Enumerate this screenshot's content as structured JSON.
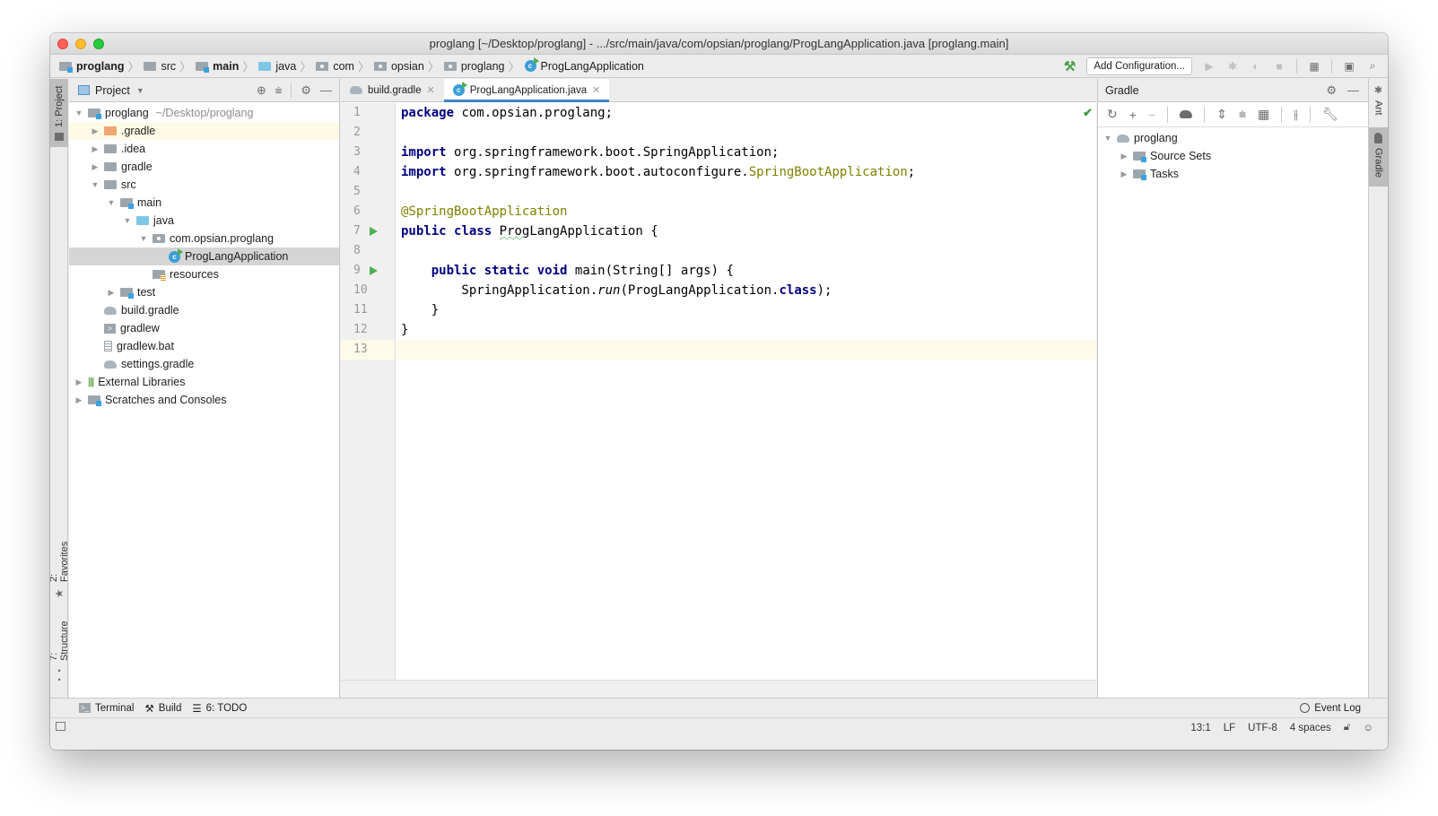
{
  "window": {
    "title": "proglang [~/Desktop/proglang] - .../src/main/java/com/opsian/proglang/ProgLangApplication.java [proglang.main]"
  },
  "navbar": {
    "breadcrumbs": [
      {
        "label": "proglang",
        "icon": "module-folder-icon",
        "bold": true
      },
      {
        "label": "src",
        "icon": "folder-icon",
        "bold": false
      },
      {
        "label": "main",
        "icon": "module-folder-icon",
        "bold": true
      },
      {
        "label": "java",
        "icon": "source-folder-icon",
        "bold": false
      },
      {
        "label": "com",
        "icon": "package-icon",
        "bold": false
      },
      {
        "label": "opsian",
        "icon": "package-icon",
        "bold": false
      },
      {
        "label": "proglang",
        "icon": "package-icon",
        "bold": false
      },
      {
        "label": "ProgLangApplication",
        "icon": "spring-class-icon",
        "bold": false
      }
    ],
    "add_configuration": "Add Configuration..."
  },
  "left_stripe": {
    "project_tab": "1: Project",
    "favorites_tab": "2: Favorites",
    "structure_tab": "7: Structure"
  },
  "right_stripe": {
    "ant_tab": "Ant",
    "gradle_tab": "Gradle"
  },
  "project_panel": {
    "title": "Project",
    "tree": [
      {
        "label": "proglang",
        "hint": "~/Desktop/proglang",
        "depth": 0,
        "arrow": "down",
        "icon": "module-folder-icon"
      },
      {
        "label": ".gradle",
        "depth": 1,
        "arrow": "right",
        "icon": "excluded-folder-icon",
        "highlight": true
      },
      {
        "label": ".idea",
        "depth": 1,
        "arrow": "right",
        "icon": "folder-icon"
      },
      {
        "label": "gradle",
        "depth": 1,
        "arrow": "right",
        "icon": "folder-icon"
      },
      {
        "label": "src",
        "depth": 1,
        "arrow": "down",
        "icon": "folder-icon"
      },
      {
        "label": "main",
        "depth": 2,
        "arrow": "down",
        "icon": "module-folder-icon"
      },
      {
        "label": "java",
        "depth": 3,
        "arrow": "down",
        "icon": "source-folder-icon"
      },
      {
        "label": "com.opsian.proglang",
        "depth": 4,
        "arrow": "down",
        "icon": "package-icon"
      },
      {
        "label": "ProgLangApplication",
        "depth": 5,
        "arrow": "",
        "icon": "spring-class-icon",
        "selected": true
      },
      {
        "label": "resources",
        "depth": 4,
        "arrow": "",
        "icon": "resources-folder-icon"
      },
      {
        "label": "test",
        "depth": 2,
        "arrow": "right",
        "icon": "module-folder-icon"
      },
      {
        "label": "build.gradle",
        "depth": 1,
        "arrow": "",
        "icon": "gradle-file-icon"
      },
      {
        "label": "gradlew",
        "depth": 1,
        "arrow": "",
        "icon": "shell-script-icon"
      },
      {
        "label": "gradlew.bat",
        "depth": 1,
        "arrow": "",
        "icon": "text-file-icon"
      },
      {
        "label": "settings.gradle",
        "depth": 1,
        "arrow": "",
        "icon": "gradle-file-icon"
      },
      {
        "label": "External Libraries",
        "depth": 0,
        "arrow": "right",
        "icon": "libraries-icon"
      },
      {
        "label": "Scratches and Consoles",
        "depth": 0,
        "arrow": "right",
        "icon": "scratches-icon"
      }
    ]
  },
  "editor": {
    "tabs": [
      {
        "label": "build.gradle",
        "icon": "gradle-file-icon",
        "active": false
      },
      {
        "label": "ProgLangApplication.java",
        "icon": "spring-class-icon",
        "active": true
      }
    ],
    "current_line": 13,
    "lines": [
      "package com.opsian.proglang;",
      "",
      "import org.springframework.boot.SpringApplication;",
      "import org.springframework.boot.autoconfigure.SpringBootApplication;",
      "",
      "@SpringBootApplication",
      "public class ProgLangApplication {",
      "",
      "    public static void main(String[] args) {",
      "        SpringApplication.run(ProgLangApplication.class);",
      "    }",
      "}",
      ""
    ],
    "run_gutter_lines": [
      7,
      9
    ]
  },
  "gradle_panel": {
    "title": "Gradle",
    "tree": [
      {
        "label": "proglang",
        "depth": 0,
        "arrow": "down",
        "icon": "gradle-elephant-icon"
      },
      {
        "label": "Source Sets",
        "depth": 1,
        "arrow": "right",
        "icon": "source-sets-icon"
      },
      {
        "label": "Tasks",
        "depth": 1,
        "arrow": "right",
        "icon": "tasks-icon"
      }
    ]
  },
  "bottom_tools": [
    {
      "label": "Terminal",
      "icon": "terminal-icon"
    },
    {
      "label": "Build",
      "icon": "hammer-icon"
    },
    {
      "label": "6: TODO",
      "icon": "list-icon"
    }
  ],
  "event_log": "Event Log",
  "status": {
    "position": "13:1",
    "line_separator": "LF",
    "encoding": "UTF-8",
    "indent": "4 spaces"
  }
}
